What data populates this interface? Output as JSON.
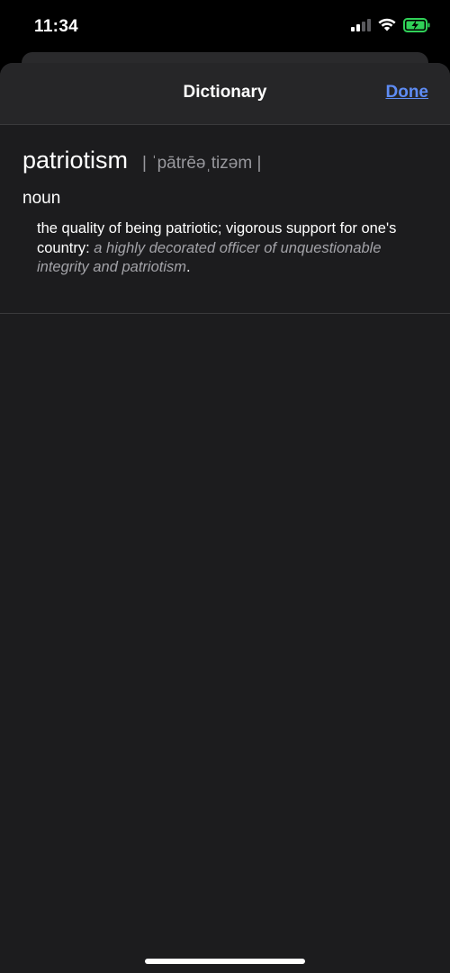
{
  "status_bar": {
    "time": "11:34",
    "icons": [
      "cellular-signal-icon",
      "wifi-icon",
      "battery-charging-icon"
    ],
    "battery_color": "#30d158"
  },
  "nav": {
    "title": "Dictionary",
    "done_label": "Done"
  },
  "entry": {
    "word": "patriotism",
    "pronunciation": "| ˈpātrēəˌtizəm |",
    "part_of_speech": "noun",
    "definition": "the quality of being patriotic; vigorous support for one's country:",
    "example": "a highly decorated officer of unquestionable integrity and patriotism",
    "example_end": "."
  },
  "colors": {
    "accent": "#5e8cf5",
    "sheet_background": "#1c1c1e",
    "secondary_text": "#98989d"
  }
}
